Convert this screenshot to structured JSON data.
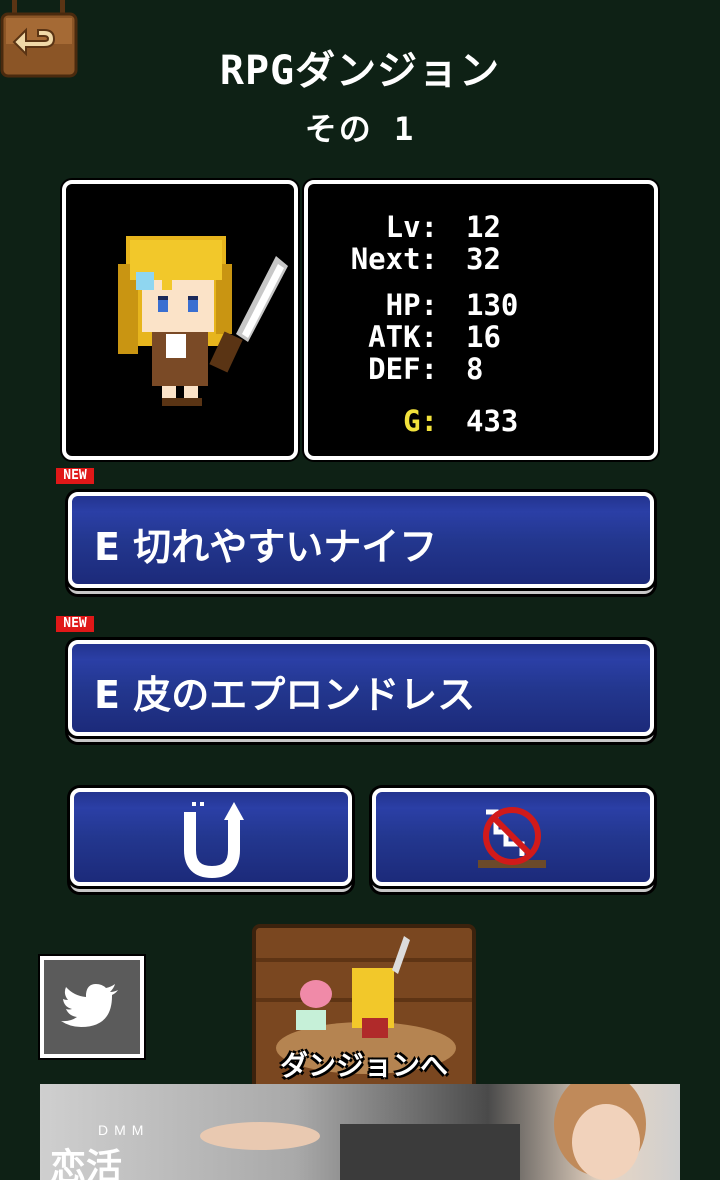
{
  "header": {
    "back_icon": "back-arrow-icon",
    "title": "RPGダンジョン",
    "subtitle": "その 1"
  },
  "stats": {
    "lv_label": "Lv:",
    "lv": "12",
    "next_label": "Next:",
    "next": "32",
    "hp_label": "HP:",
    "hp": "130",
    "atk_label": "ATK:",
    "atk": "16",
    "def_label": "DEF:",
    "def": "8",
    "gold_label": "G:",
    "gold": "433"
  },
  "equipment": [
    {
      "badge": "NEW",
      "label": "E 切れやすいナイフ"
    },
    {
      "badge": "NEW",
      "label": "E 皮のエプロンドレス"
    }
  ],
  "actions": {
    "magnet_icon": "magnet-up-icon",
    "no_stairs_icon": "no-stairs-icon"
  },
  "twitter": {
    "icon": "twitter-bird-icon"
  },
  "dungeon": {
    "label": "ダンジョンへ"
  },
  "ad": {
    "brand_top": "DMM",
    "brand": "恋活"
  },
  "colors": {
    "background": "#0e2115",
    "button_blue": "#23348f",
    "gold": "#f2e23c",
    "new_badge": "#e01818"
  }
}
